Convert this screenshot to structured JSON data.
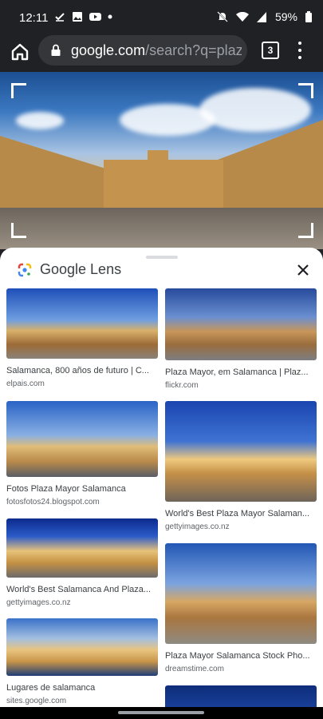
{
  "status_bar": {
    "time": "12:11",
    "battery": "59%",
    "icons": [
      "check-icon",
      "image-icon",
      "youtube-icon",
      "dot-icon",
      "mute-icon",
      "wifi-icon",
      "signal-icon",
      "battery-icon"
    ]
  },
  "browser": {
    "url_domain": "google.com",
    "url_path": "/search?q=plaza",
    "tab_count": "3"
  },
  "lens": {
    "title": "Google Lens"
  },
  "results_left": [
    {
      "title": "Salamanca, 800 años de futuro | C...",
      "source": "elpais.com"
    },
    {
      "title": "Fotos Plaza Mayor Salamanca",
      "source": "fotosfotos24.blogspot.com"
    },
    {
      "title": "World's Best Salamanca And Plaza...",
      "source": "gettyimages.co.nz"
    },
    {
      "title": "Lugares de salamanca",
      "source": "sites.google.com"
    }
  ],
  "results_right": [
    {
      "title": "Plaza Mayor, em Salamanca | Plaz...",
      "source": "flickr.com"
    },
    {
      "title": "World's Best Plaza Mayor Salaman...",
      "source": "gettyimages.co.nz"
    },
    {
      "title": "Plaza Mayor Salamanca Stock Pho...",
      "source": "dreamstime.com"
    }
  ],
  "colors": {
    "chrome_dark": "#202124",
    "omnibox": "#35363a",
    "sheet": "#ffffff",
    "text": "#3c4043",
    "secondary_text": "#5f6368"
  }
}
